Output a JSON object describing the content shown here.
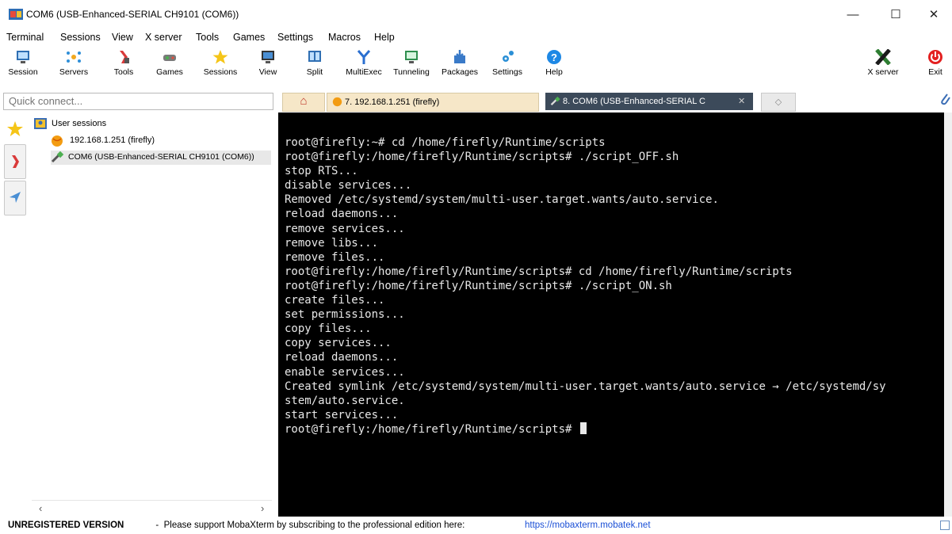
{
  "window": {
    "title": "COM6  (USB-Enhanced-SERIAL CH9101 (COM6))",
    "minimize_glyph": "—",
    "maximize_glyph": "☐",
    "close_glyph": "✕"
  },
  "menu": [
    "Terminal",
    "Sessions",
    "View",
    "X server",
    "Tools",
    "Games",
    "Settings",
    "Macros",
    "Help"
  ],
  "toolbar": {
    "left": [
      {
        "label": "Session",
        "icon": "session-icon"
      },
      {
        "label": "Servers",
        "icon": "servers-icon"
      },
      {
        "label": "Tools",
        "icon": "tools-icon"
      },
      {
        "label": "Games",
        "icon": "games-icon"
      },
      {
        "label": "Sessions",
        "icon": "sessions-star-icon"
      },
      {
        "label": "View",
        "icon": "view-icon"
      },
      {
        "label": "Split",
        "icon": "split-icon"
      },
      {
        "label": "MultiExec",
        "icon": "multiexec-icon"
      },
      {
        "label": "Tunneling",
        "icon": "tunneling-icon"
      },
      {
        "label": "Packages",
        "icon": "packages-icon"
      },
      {
        "label": "Settings",
        "icon": "settings-icon"
      },
      {
        "label": "Help",
        "icon": "help-icon"
      }
    ],
    "right": [
      {
        "label": "X server",
        "icon": "x-server-icon"
      },
      {
        "label": "Exit",
        "icon": "exit-icon"
      }
    ]
  },
  "quick_connect": {
    "placeholder": "Quick connect..."
  },
  "sessions_tree": {
    "root_label": "User sessions",
    "items": [
      "192.168.1.251 (firefly)",
      "COM6  (USB-Enhanced-SERIAL CH9101 (COM6))"
    ]
  },
  "tabs": {
    "home_glyph": "⌂",
    "items": [
      {
        "label": "7. 192.168.1.251 (firefly)",
        "active": false
      },
      {
        "label": "8. COM6  (USB-Enhanced-SERIAL C",
        "active": true
      }
    ],
    "close_glyph": "✕",
    "new_tab_glyph": "◇"
  },
  "terminal": {
    "lines": [
      "root@firefly:~# cd /home/firefly/Runtime/scripts",
      "root@firefly:/home/firefly/Runtime/scripts# ./script_OFF.sh",
      "stop RTS...",
      "disable services...",
      "Removed /etc/systemd/system/multi-user.target.wants/auto.service.",
      "reload daemons...",
      "remove services...",
      "remove libs...",
      "remove files...",
      "root@firefly:/home/firefly/Runtime/scripts# cd /home/firefly/Runtime/scripts",
      "root@firefly:/home/firefly/Runtime/scripts# ./script_ON.sh",
      "create files...",
      "set permissions...",
      "copy files...",
      "copy services...",
      "reload daemons...",
      "enable services...",
      "Created symlink /etc/systemd/system/multi-user.target.wants/auto.service → /etc/systemd/sy",
      "stem/auto.service.",
      "start services..."
    ],
    "prompt": "root@firefly:/home/firefly/Runtime/scripts# "
  },
  "status": {
    "bold": "UNREGISTERED VERSION",
    "message": "  -  Please support MobaXterm by subscribing to the professional edition here:  ",
    "link": "https://mobaxterm.mobatek.net"
  },
  "colors": {
    "terminal_bg": "#000000",
    "terminal_fg": "#e8e8e8",
    "active_tab": "#3c4a5a",
    "inactive_tab": "#f6e7c8",
    "link": "#1a4fd6",
    "exit_red": "#e32020"
  }
}
